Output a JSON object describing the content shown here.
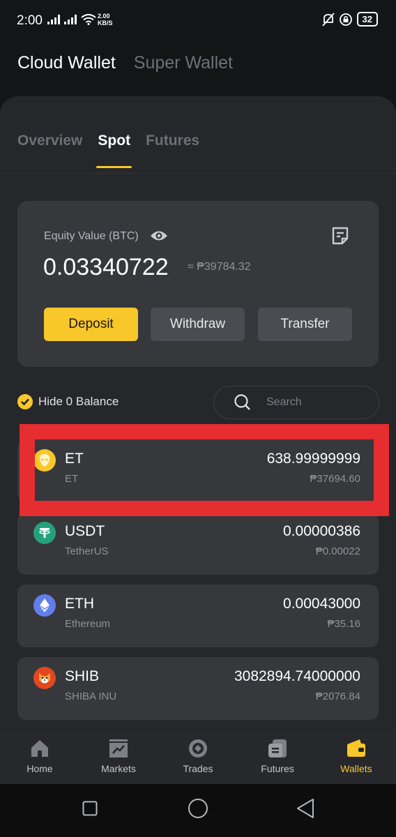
{
  "status_bar": {
    "time": "2:00",
    "net_speed_value": "2.00",
    "net_speed_unit": "KB/S",
    "battery": "32"
  },
  "wallet_tabs": [
    "Cloud Wallet",
    "Super Wallet"
  ],
  "sub_tabs": [
    "Overview",
    "Spot",
    "Futures"
  ],
  "equity": {
    "label": "Equity Value (BTC)",
    "value": "0.03340722",
    "fiat": "≈ ₱39784.32"
  },
  "actions": {
    "deposit": "Deposit",
    "withdraw": "Withdraw",
    "transfer": "Transfer"
  },
  "filter": {
    "hide_zero_label": "Hide 0 Balance",
    "search_placeholder": "Search"
  },
  "coins": [
    {
      "symbol": "ET",
      "name": "ET",
      "amount": "638.99999999",
      "fiat": "₱37694.60",
      "icon": "alien-icon",
      "color": "#f8c72a"
    },
    {
      "symbol": "USDT",
      "name": "TetherUS",
      "amount": "0.00000386",
      "fiat": "₱0.00022",
      "icon": "tether-icon",
      "color": "#26a17b"
    },
    {
      "symbol": "ETH",
      "name": "Ethereum",
      "amount": "0.00043000",
      "fiat": "₱35.16",
      "icon": "ethereum-icon",
      "color": "#627eea"
    },
    {
      "symbol": "SHIB",
      "name": "SHIBA INU",
      "amount": "3082894.74000000",
      "fiat": "₱2076.84",
      "icon": "shiba-icon",
      "color": "#e2481f"
    }
  ],
  "bottom_nav": [
    {
      "label": "Home",
      "icon": "home-icon"
    },
    {
      "label": "Markets",
      "icon": "chart-icon"
    },
    {
      "label": "Trades",
      "icon": "trades-icon"
    },
    {
      "label": "Futures",
      "icon": "futures-icon"
    },
    {
      "label": "Wallets",
      "icon": "wallet-icon"
    }
  ],
  "colors": {
    "accent": "#f8c72a",
    "highlight_box": "#e62d2f",
    "background": "#141517",
    "card": "#36383c"
  }
}
